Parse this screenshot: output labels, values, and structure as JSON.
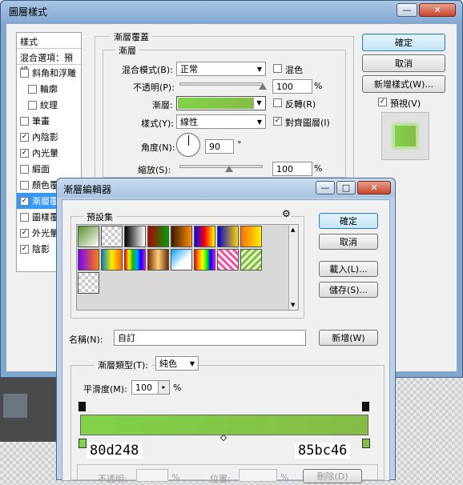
{
  "layer_style": {
    "title": "圖層樣式",
    "window_controls": {
      "minimize": "—",
      "close": "✕"
    },
    "styles_header": "樣式",
    "blend_options_label": "混合選項：預設",
    "style_items": [
      {
        "label": "斜角和浮雕",
        "checked": false,
        "indent": false
      },
      {
        "label": "輪廓",
        "checked": false,
        "indent": true
      },
      {
        "label": "紋理",
        "checked": false,
        "indent": true
      },
      {
        "label": "筆畫",
        "checked": false,
        "indent": false
      },
      {
        "label": "內陰影",
        "checked": true,
        "indent": false
      },
      {
        "label": "內光暈",
        "checked": true,
        "indent": false
      },
      {
        "label": "緞面",
        "checked": false,
        "indent": false
      },
      {
        "label": "顏色覆",
        "checked": false,
        "indent": false
      },
      {
        "label": "漸層覆",
        "checked": true,
        "indent": false,
        "selected": true
      },
      {
        "label": "圖樣覆",
        "checked": false,
        "indent": false
      },
      {
        "label": "外光暈",
        "checked": true,
        "indent": false
      },
      {
        "label": "陰影",
        "checked": true,
        "indent": false
      }
    ],
    "group_title": "漸層覆蓋",
    "subgroup_title": "漸層",
    "blend_mode_label": "混合模式(B):",
    "blend_mode_value": "正常",
    "dither_label": "混色",
    "dither_checked": false,
    "opacity_label": "不透明(P):",
    "opacity_value": "100",
    "opacity_unit": "%",
    "opacity_fraction": 1.0,
    "gradient_label": "漸層:",
    "reverse_label": "反轉(R)",
    "reverse_checked": false,
    "style_label": "樣式(Y):",
    "style_value": "線性",
    "align_label": "對齊圖層(I)",
    "align_checked": true,
    "angle_label": "角度(N):",
    "angle_value": "90",
    "angle_unit": "°",
    "scale_label": "縮放(S):",
    "scale_value": "100",
    "scale_unit": "%",
    "scale_fraction": 0.6,
    "ok_label": "確定",
    "cancel_label": "取消",
    "new_style_label": "新增樣式(W)...",
    "preview_label": "預視(V)",
    "preview_checked": true
  },
  "gradient_editor": {
    "title": "漸層編輯器",
    "window_controls": {
      "minimize": "—",
      "maximize": "□",
      "close": "✕"
    },
    "presets_label": "預設集",
    "gear_icon": "⚙",
    "ok_label": "確定",
    "cancel_label": "取消",
    "load_label": "載入(L)...",
    "save_label": "儲存(S)...",
    "name_label": "名稱(N):",
    "name_value": "自訂",
    "new_label": "新增(W)",
    "gradient_type_label": "漸層類型(T):",
    "gradient_type_value": "純色",
    "smoothness_label": "平滑度(M):",
    "smoothness_value": "100",
    "smoothness_unit": "%",
    "stop_left_color": "80d248",
    "stop_right_color": "85bc46",
    "stops_group": {
      "opacity_label": "不透明:",
      "percent_unit": "%",
      "location_label": "位置:",
      "location_unit": "%",
      "delete_label": "刪除(D)"
    }
  },
  "colors": {
    "gradient_start": "#80d248",
    "gradient_end": "#85bc46",
    "selection": "#3399ff"
  }
}
